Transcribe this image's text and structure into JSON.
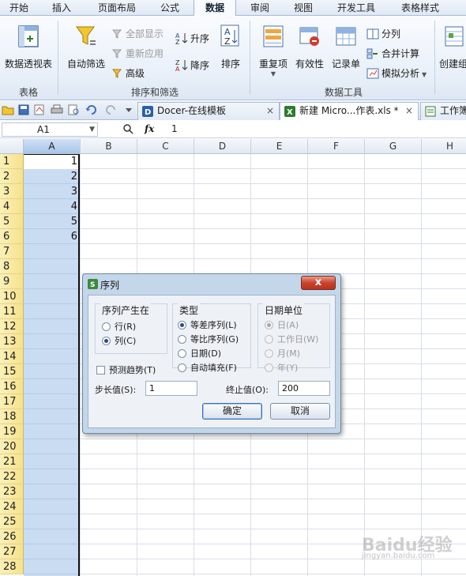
{
  "ribbon_tabs": [
    "开始",
    "插入",
    "页面布局",
    "公式",
    "数据",
    "审阅",
    "视图",
    "开发工具",
    "表格样式"
  ],
  "active_tab": "数据",
  "ribbon": {
    "pivot_label": "数据透视表",
    "autofilter_label": "自动筛选",
    "show_all_label": "全部显示",
    "reapply_label": "重新应用",
    "advanced_label": "高级",
    "sort_asc_label": "升序",
    "sort_desc_label": "降序",
    "sort_label": "排序",
    "duplicates_label": "重复项",
    "validity_label": "有效性",
    "record_label": "记录单",
    "split_label": "分列",
    "consolidate_label": "合并计算",
    "whatif_label": "模拟分析",
    "create_group_label": "创建组",
    "group_table": "表格",
    "group_sort_filter": "排序和筛选",
    "group_data_tools": "数据工具"
  },
  "doc_tabs": [
    {
      "label": "Docer-在线模板",
      "close": "×"
    },
    {
      "label": "新建 Micro...作表.xls *",
      "close": "×"
    },
    {
      "label": "工作簿"
    }
  ],
  "formula_bar": {
    "cell_ref": "A1",
    "fx": "fx",
    "value": "1"
  },
  "columns": [
    "A",
    "B",
    "C",
    "D",
    "E",
    "F",
    "G",
    "H"
  ],
  "rows": [
    "1",
    "2",
    "3",
    "4",
    "5",
    "6",
    "7",
    "8",
    "9",
    "10",
    "11",
    "12",
    "13",
    "14",
    "15",
    "16",
    "17",
    "18",
    "19",
    "20",
    "21",
    "22",
    "23",
    "24",
    "25",
    "26",
    "27",
    "28"
  ],
  "column_a_values": [
    "1",
    "2",
    "3",
    "4",
    "5",
    "6"
  ],
  "dialog": {
    "title": "序列",
    "close": "x",
    "series_in": {
      "title": "序列产生在",
      "rows": "行(R)",
      "columns": "列(C)",
      "selected": "列(C)"
    },
    "type": {
      "title": "类型",
      "linear": "等差序列(L)",
      "growth": "等比序列(G)",
      "date": "日期(D)",
      "autofill": "自动填充(F)",
      "selected": "等差序列(L)"
    },
    "date_unit": {
      "title": "日期单位",
      "day": "日(A)",
      "weekday": "工作日(W)",
      "month": "月(M)",
      "year": "年(Y)"
    },
    "trend_label": "预测趋势(T)",
    "step_label": "步长值(S):",
    "step_value": "1",
    "stop_label": "终止值(O):",
    "stop_value": "200",
    "ok_label": "确定",
    "cancel_label": "取消"
  },
  "watermark": {
    "brand": "Baidu经验",
    "url": "jingyan.baidu.com"
  }
}
